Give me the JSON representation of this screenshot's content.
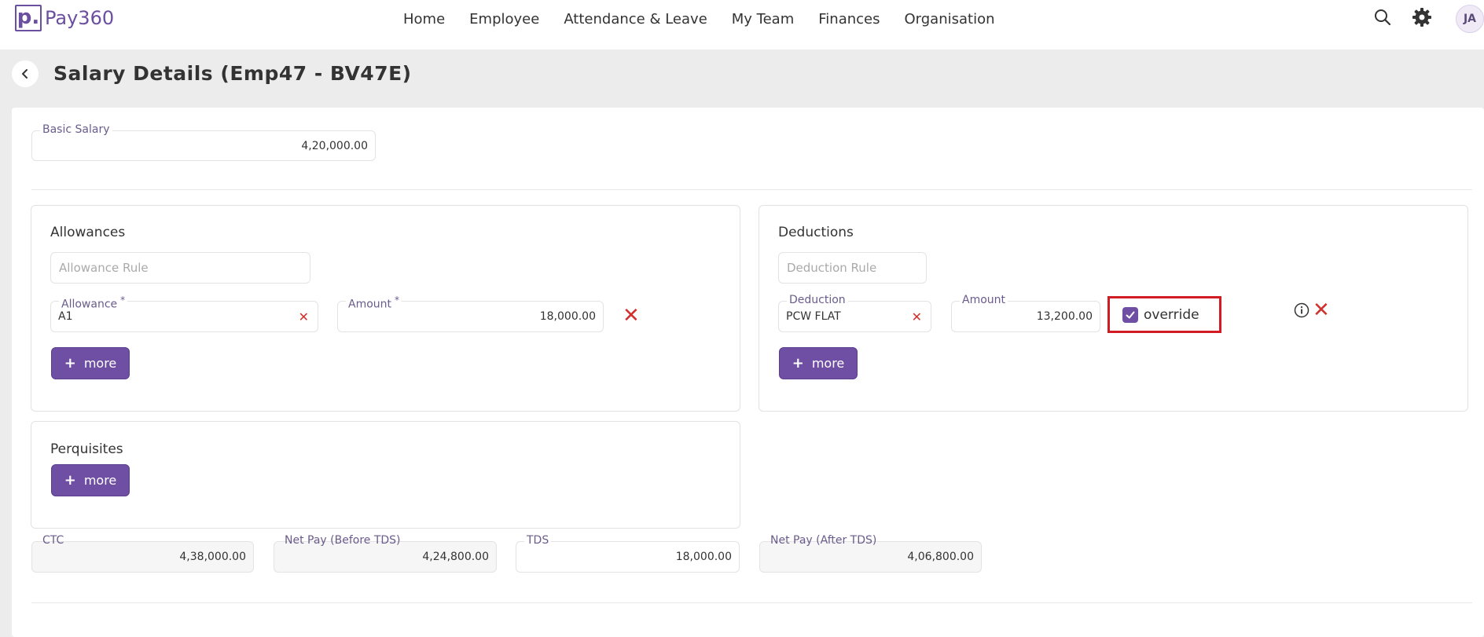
{
  "app": {
    "logo_letter": "p.",
    "name": "Pay360"
  },
  "nav": [
    "Home",
    "Employee",
    "Attendance & Leave",
    "My Team",
    "Finances",
    "Organisation"
  ],
  "user": {
    "initials": "JA"
  },
  "page": {
    "title": "Salary Details (Emp47 - BV47E)"
  },
  "basic_salary": {
    "label": "Basic Salary",
    "value": "4,20,000.00"
  },
  "allowances": {
    "title": "Allowances",
    "rule_placeholder": "Allowance Rule",
    "allowance_label": "Allowance",
    "allowance_value": "A1",
    "amount_label": "Amount",
    "amount_value": "18,000.00",
    "more_label": "more"
  },
  "deductions": {
    "title": "Deductions",
    "rule_placeholder": "Deduction Rule",
    "deduction_label": "Deduction",
    "deduction_value": "PCW FLAT",
    "amount_label": "Amount",
    "amount_value": "13,200.00",
    "override_label": "override",
    "override_checked": true,
    "more_label": "more"
  },
  "perquisites": {
    "title": "Perquisites",
    "more_label": "more"
  },
  "totals": {
    "ctc_label": "CTC",
    "ctc_value": "4,38,000.00",
    "net_before_label": "Net Pay (Before TDS)",
    "net_before_value": "4,24,800.00",
    "tds_label": "TDS",
    "tds_value": "18,000.00",
    "net_after_label": "Net Pay (After TDS)",
    "net_after_value": "4,06,800.00"
  },
  "colors": {
    "brand": "#6f4fa3",
    "danger": "#d0312d",
    "highlight": "#d01c22"
  }
}
